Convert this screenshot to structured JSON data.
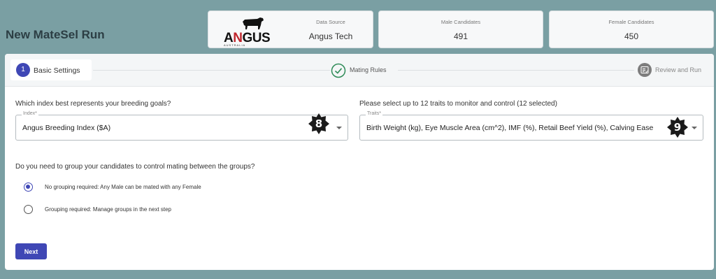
{
  "header": {
    "title": "New MateSel Run"
  },
  "cards": {
    "source": {
      "label": "Data Source",
      "value": "Angus Tech",
      "logo_text": "ANGUS",
      "logo_subtext": "AUSTRALIA"
    },
    "male": {
      "label": "Male Candidates",
      "value": "491"
    },
    "female": {
      "label": "Female Candidates",
      "value": "450"
    }
  },
  "stepper": {
    "steps": [
      {
        "number": "1",
        "label": "Basic Settings",
        "state": "active"
      },
      {
        "label": "Mating Rules",
        "state": "complete",
        "icon": "check-circle-icon"
      },
      {
        "label": "Review and Run",
        "state": "pending",
        "icon": "review-icon"
      }
    ]
  },
  "form": {
    "index_question": "Which index best represents your breeding goals?",
    "index_label": "Index*",
    "index_value": "Angus Breeding Index ($A)",
    "traits_question": "Please select up to 12 traits to monitor and control (12 selected)",
    "traits_label": "Traits*",
    "traits_value": "Birth Weight (kg), Eye Muscle Area (cm^2), IMF (%), Retail Beef Yield (%), Calving Ease",
    "group_question": "Do you need to group your candidates to control mating between the groups?",
    "options": [
      {
        "label": "No grouping required: Any Male can be mated with any Female",
        "selected": true
      },
      {
        "label": "Grouping required: Manage groups in the next step",
        "selected": false
      }
    ],
    "next_label": "Next"
  },
  "badges": {
    "index_badge": "8",
    "traits_badge": "9"
  },
  "colors": {
    "accent": "#3f47b5",
    "background": "#7a9fa3",
    "success": "#2e8b57"
  }
}
